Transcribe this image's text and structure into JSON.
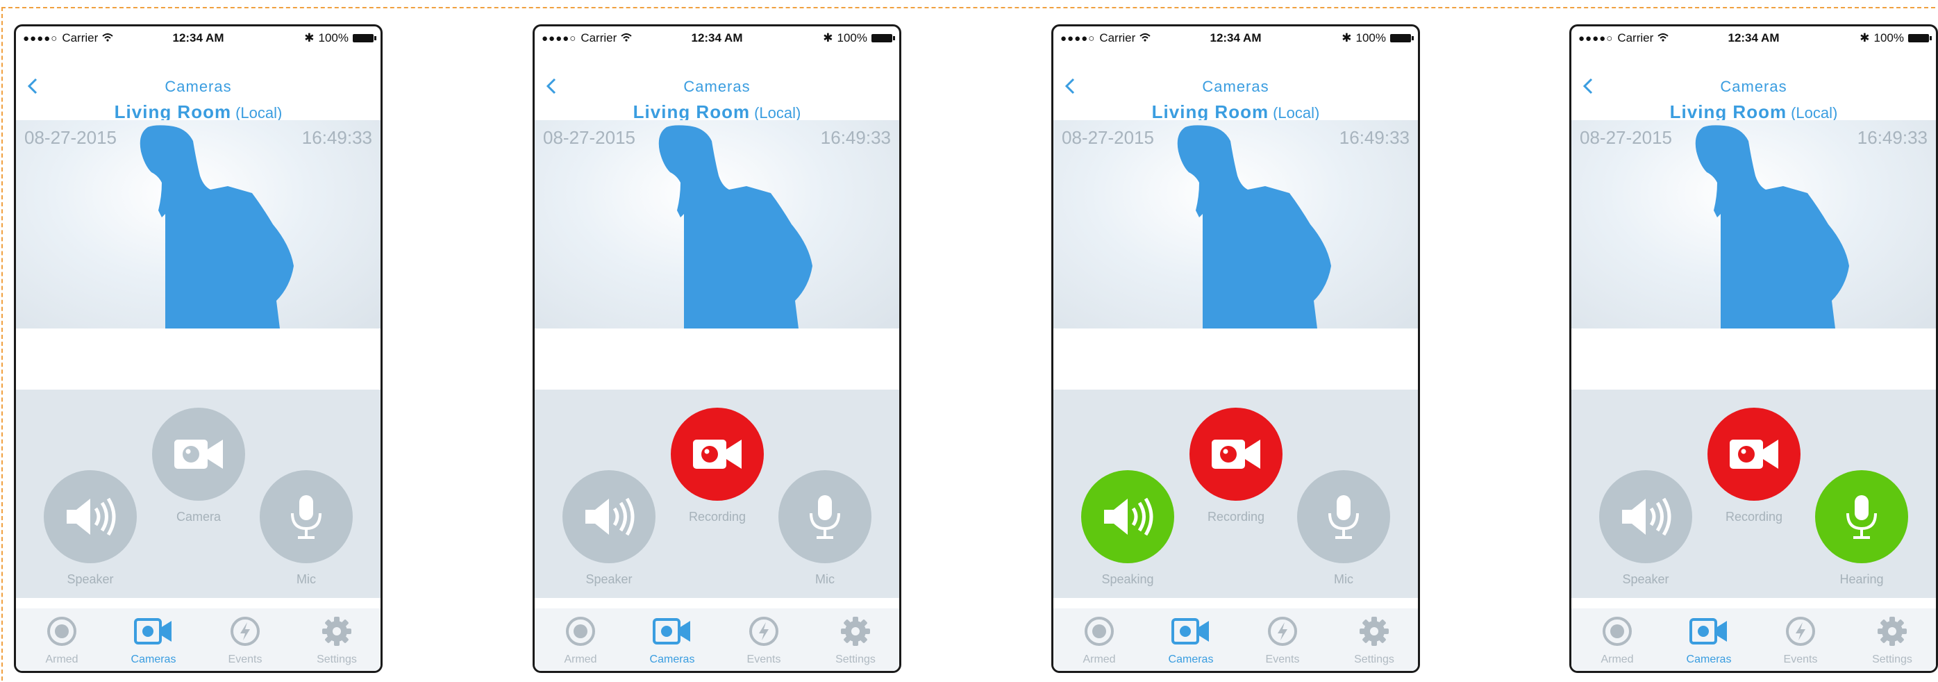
{
  "status": {
    "carrier": "Carrier",
    "time": "12:34 AM",
    "battery": "100%"
  },
  "nav": {
    "title": "Cameras",
    "room": "Living Room",
    "mode": "(Local)"
  },
  "feed": {
    "date": "08-27-2015",
    "time": "16:49:33"
  },
  "colors": {
    "accent": "#3a9de0",
    "record": "#e8161b",
    "active_audio": "#5fc70f",
    "inactive": "#b9c5cd"
  },
  "tabs": [
    "Armed",
    "Cameras",
    "Events",
    "Settings"
  ],
  "screens": [
    {
      "speaker": "Speaker",
      "camera": "Camera",
      "mic": "Mic",
      "speaker_state": "inactive",
      "camera_state": "inactive",
      "mic_state": "inactive"
    },
    {
      "speaker": "Speaker",
      "camera": "Recording",
      "mic": "Mic",
      "speaker_state": "inactive",
      "camera_state": "recording",
      "mic_state": "inactive"
    },
    {
      "speaker": "Speaking",
      "camera": "Recording",
      "mic": "Mic",
      "speaker_state": "active",
      "camera_state": "recording",
      "mic_state": "inactive"
    },
    {
      "speaker": "Speaker",
      "camera": "Recording",
      "mic": "Hearing",
      "speaker_state": "inactive",
      "camera_state": "recording",
      "mic_state": "active"
    }
  ]
}
